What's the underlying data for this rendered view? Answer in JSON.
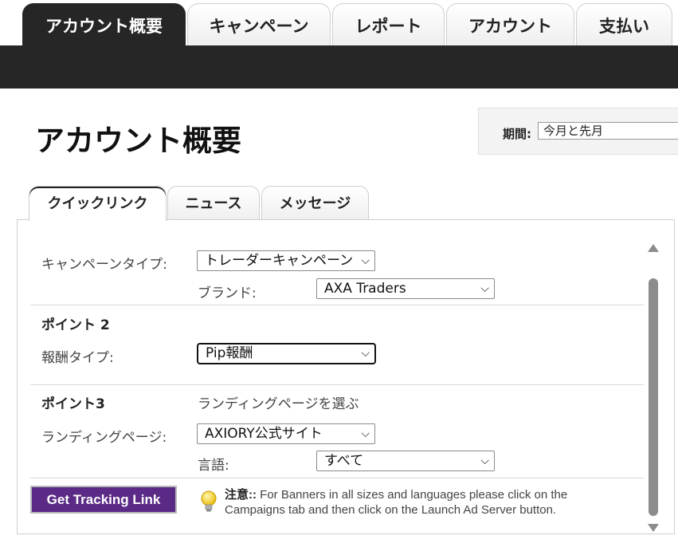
{
  "nav": {
    "tabs": [
      {
        "label": "アカウント概要",
        "active": true
      },
      {
        "label": "キャンペーン"
      },
      {
        "label": "レポート"
      },
      {
        "label": "アカウント"
      },
      {
        "label": "支払い"
      }
    ]
  },
  "header": {
    "title": "アカウント概要",
    "period_label": "期間:",
    "period_value": "今月と先月"
  },
  "subtabs": [
    {
      "label": "クイックリンク",
      "active": true
    },
    {
      "label": "ニュース"
    },
    {
      "label": "メッセージ"
    }
  ],
  "form": {
    "campaign_type_label": "キャンペーンタイプ:",
    "campaign_type_value": "トレーダーキャンペーン",
    "brand_label": "ブランド:",
    "brand_value": "AXA Traders",
    "point2_heading": "ポイント 2",
    "reward_type_label": "報酬タイプ:",
    "reward_type_value": "Pip報酬",
    "point3_heading": "ポイント3",
    "point3_desc": "ランディングページを選ぶ",
    "landing_page_label": "ランディングページ:",
    "landing_page_value": "AXIORY公式サイト",
    "language_label": "言語:",
    "language_value": "すべて"
  },
  "actions": {
    "tracking_button": "Get Tracking Link",
    "note_prefix": "注意::",
    "note_text": " For Banners in all sizes and languages please click on the Campaigns tab and then click on the Launch Ad Server button."
  },
  "colors": {
    "nav_dark": "#262626",
    "button_purple": "#5a2a86",
    "scroll_thumb": "#8c8c8c"
  }
}
